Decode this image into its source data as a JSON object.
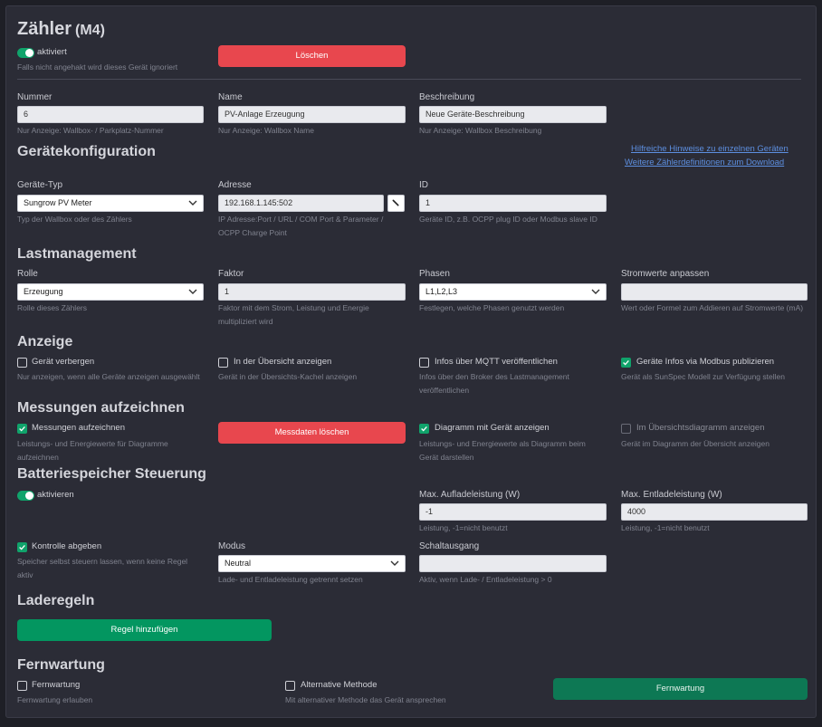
{
  "header": {
    "title": "Zähler",
    "subtitle": "(M4)",
    "toggle_label": "aktiviert",
    "toggle_help": "Falls nicht angehakt wird dieses Gerät ignoriert",
    "delete_label": "Löschen"
  },
  "general": {
    "nummer": {
      "label": "Nummer",
      "value": "6",
      "help": "Nur Anzeige: Wallbox- / Parkplatz-Nummer"
    },
    "name": {
      "label": "Name",
      "value": "PV-Anlage Erzeugung",
      "help": "Nur Anzeige: Wallbox Name"
    },
    "beschreibung": {
      "label": "Beschreibung",
      "value": "Neue Geräte-Beschreibung",
      "help": "Nur Anzeige: Wallbox Beschreibung"
    }
  },
  "config": {
    "heading": "Gerätekonfiguration",
    "link1": "Hilfreiche Hinweise zu einzelnen Geräten",
    "link2": "Weitere Zählerdefinitionen zum Download",
    "type": {
      "label": "Geräte-Typ",
      "value": "Sungrow PV Meter",
      "help": "Typ der Wallbox oder des Zählers"
    },
    "address": {
      "label": "Adresse",
      "value": "192.168.1.145:502",
      "help1": "IP Adresse:Port / URL / COM Port & Parameter /",
      "help2": "OCPP Charge Point"
    },
    "id": {
      "label": "ID",
      "value": "1",
      "help": "Geräte ID, z.B. OCPP plug ID oder Modbus slave ID"
    }
  },
  "load": {
    "heading": "Lastmanagement",
    "rolle": {
      "label": "Rolle",
      "value": "Erzeugung",
      "help": "Rolle dieses Zählers"
    },
    "faktor": {
      "label": "Faktor",
      "value": "1",
      "help1": "Faktor mit dem Strom, Leistung und Energie",
      "help2": "multipliziert wird"
    },
    "phasen": {
      "label": "Phasen",
      "value": "L1,L2,L3",
      "help": "Festlegen, welche Phasen genutzt werden"
    },
    "strom": {
      "label": "Stromwerte anpassen",
      "value": "",
      "help": "Wert oder Formel zum Addieren auf Stromwerte (mA)"
    }
  },
  "display": {
    "heading": "Anzeige",
    "hide": {
      "label": "Gerät verbergen",
      "help": "Nur anzeigen, wenn alle Geräte anzeigen ausgewählt",
      "checked": false
    },
    "overview": {
      "label": "In der Übersicht anzeigen",
      "help": "Gerät in der Übersichts-Kachel anzeigen",
      "checked": false
    },
    "mqtt": {
      "label": "Infos über MQTT veröffentlichen",
      "help1": "Infos über den Broker des Lastmanagement",
      "help2": "veröffentlichen",
      "checked": false
    },
    "modbus": {
      "label": "Geräte Infos via Modbus publizieren",
      "help": "Gerät als SunSpec Modell zur Verfügung stellen",
      "checked": true
    }
  },
  "records": {
    "heading": "Messungen aufzeichnen",
    "record": {
      "label": "Messungen aufzeichnen",
      "help1": "Leistungs- und Energiewerte für Diagramme",
      "help2": "aufzeichnen",
      "checked": true
    },
    "delete_label": "Messdaten löschen",
    "diagram": {
      "label": "Diagramm mit Gerät anzeigen",
      "help1": "Leistungs- und Energiewerte als Diagramm beim",
      "help2": "Gerät darstellen",
      "checked": true
    },
    "overview_diagram": {
      "label": "Im Übersichtsdiagramm anzeigen",
      "help": "Gerät im Diagramm der Übersicht anzeigen",
      "checked": false
    }
  },
  "battery": {
    "heading": "Batteriespeicher Steuerung",
    "toggle_label": "aktivieren",
    "charge": {
      "label": "Max. Aufladeleistung (W)",
      "value": "-1",
      "help": "Leistung, -1=nicht benutzt"
    },
    "discharge": {
      "label": "Max. Entladeleistung (W)",
      "value": "4000",
      "help": "Leistung, -1=nicht benutzt"
    },
    "control": {
      "label": "Kontrolle abgeben",
      "help1": "Speicher selbst steuern lassen, wenn keine Regel",
      "help2": "aktiv",
      "checked": true
    },
    "mode": {
      "label": "Modus",
      "value": "Neutral",
      "help": "Lade- und Entladeleistung getrennt setzen"
    },
    "output": {
      "label": "Schaltausgang",
      "value": "",
      "help": "Aktiv, wenn Lade- / Entladeleistung > 0"
    }
  },
  "rules": {
    "heading": "Laderegeln",
    "add_label": "Regel hinzufügen"
  },
  "remote": {
    "heading": "Fernwartung",
    "enable": {
      "label": "Fernwartung",
      "help": "Fernwartung erlauben",
      "checked": false
    },
    "alt": {
      "label": "Alternative Methode",
      "help": "Mit alternativer Methode das Gerät ansprechen",
      "checked": false
    },
    "button_label": "Fernwartung"
  },
  "colors": {
    "accent_green": "#10a36b",
    "danger_red": "#e8474e",
    "link_blue": "#5d8fe0",
    "panel_bg": "#2b2c36"
  }
}
